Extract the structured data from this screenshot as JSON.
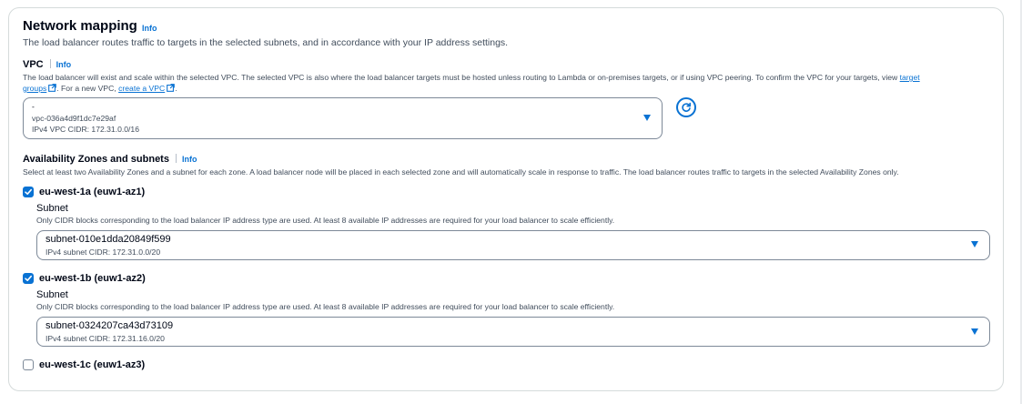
{
  "section": {
    "title": "Network mapping",
    "info": "Info",
    "description": "The load balancer routes traffic to targets in the selected subnets, and in accordance with your IP address settings."
  },
  "vpc": {
    "label": "VPC",
    "info": "Info",
    "help_line1_prefix": "The load balancer will exist and scale within the selected VPC. The selected VPC is also where the load balancer targets must be hosted unless routing to Lambda or on-premises targets, or if using VPC peering. To confirm the VPC for your targets, view",
    "help_link_target_groups_1": "target",
    "help_link_target_groups_2": "groups",
    "help_line2_mid": ". For a new VPC,",
    "help_link_create_vpc": "create a VPC",
    "help_line2_end": ".",
    "select": {
      "name": "-",
      "id": "vpc-036a4d9f1dc7e29af",
      "cidr": "IPv4 VPC CIDR: 172.31.0.0/16"
    },
    "icons": {
      "refresh": "refresh-icon",
      "external": "external-link-icon",
      "caret": "caret-down-icon"
    }
  },
  "az": {
    "label": "Availability Zones and subnets",
    "info": "Info",
    "description": "Select at least two Availability Zones and a subnet for each zone. A load balancer node will be placed in each selected zone and will automatically scale in response to traffic. The load balancer routes traffic to targets in the selected Availability Zones only.",
    "zones": [
      {
        "name": "eu-west-1a (euw1-az1)",
        "checked": true,
        "subnet_label": "Subnet",
        "subnet_help": "Only CIDR blocks corresponding to the load balancer IP address type are used. At least 8 available IP addresses are required for your load balancer to scale efficiently.",
        "subnet_id": "subnet-010e1dda20849f599",
        "subnet_cidr": "IPv4 subnet CIDR: 172.31.0.0/20"
      },
      {
        "name": "eu-west-1b (euw1-az2)",
        "checked": true,
        "subnet_label": "Subnet",
        "subnet_help": "Only CIDR blocks corresponding to the load balancer IP address type are used. At least 8 available IP addresses are required for your load balancer to scale efficiently.",
        "subnet_id": "subnet-0324207ca43d73109",
        "subnet_cidr": "IPv4 subnet CIDR: 172.31.16.0/20"
      },
      {
        "name": "eu-west-1c (euw1-az3)",
        "checked": false
      }
    ]
  },
  "colors": {
    "accent": "#0972d3",
    "text": "#000716",
    "muted": "#414d5c",
    "border": "#7d8998"
  }
}
